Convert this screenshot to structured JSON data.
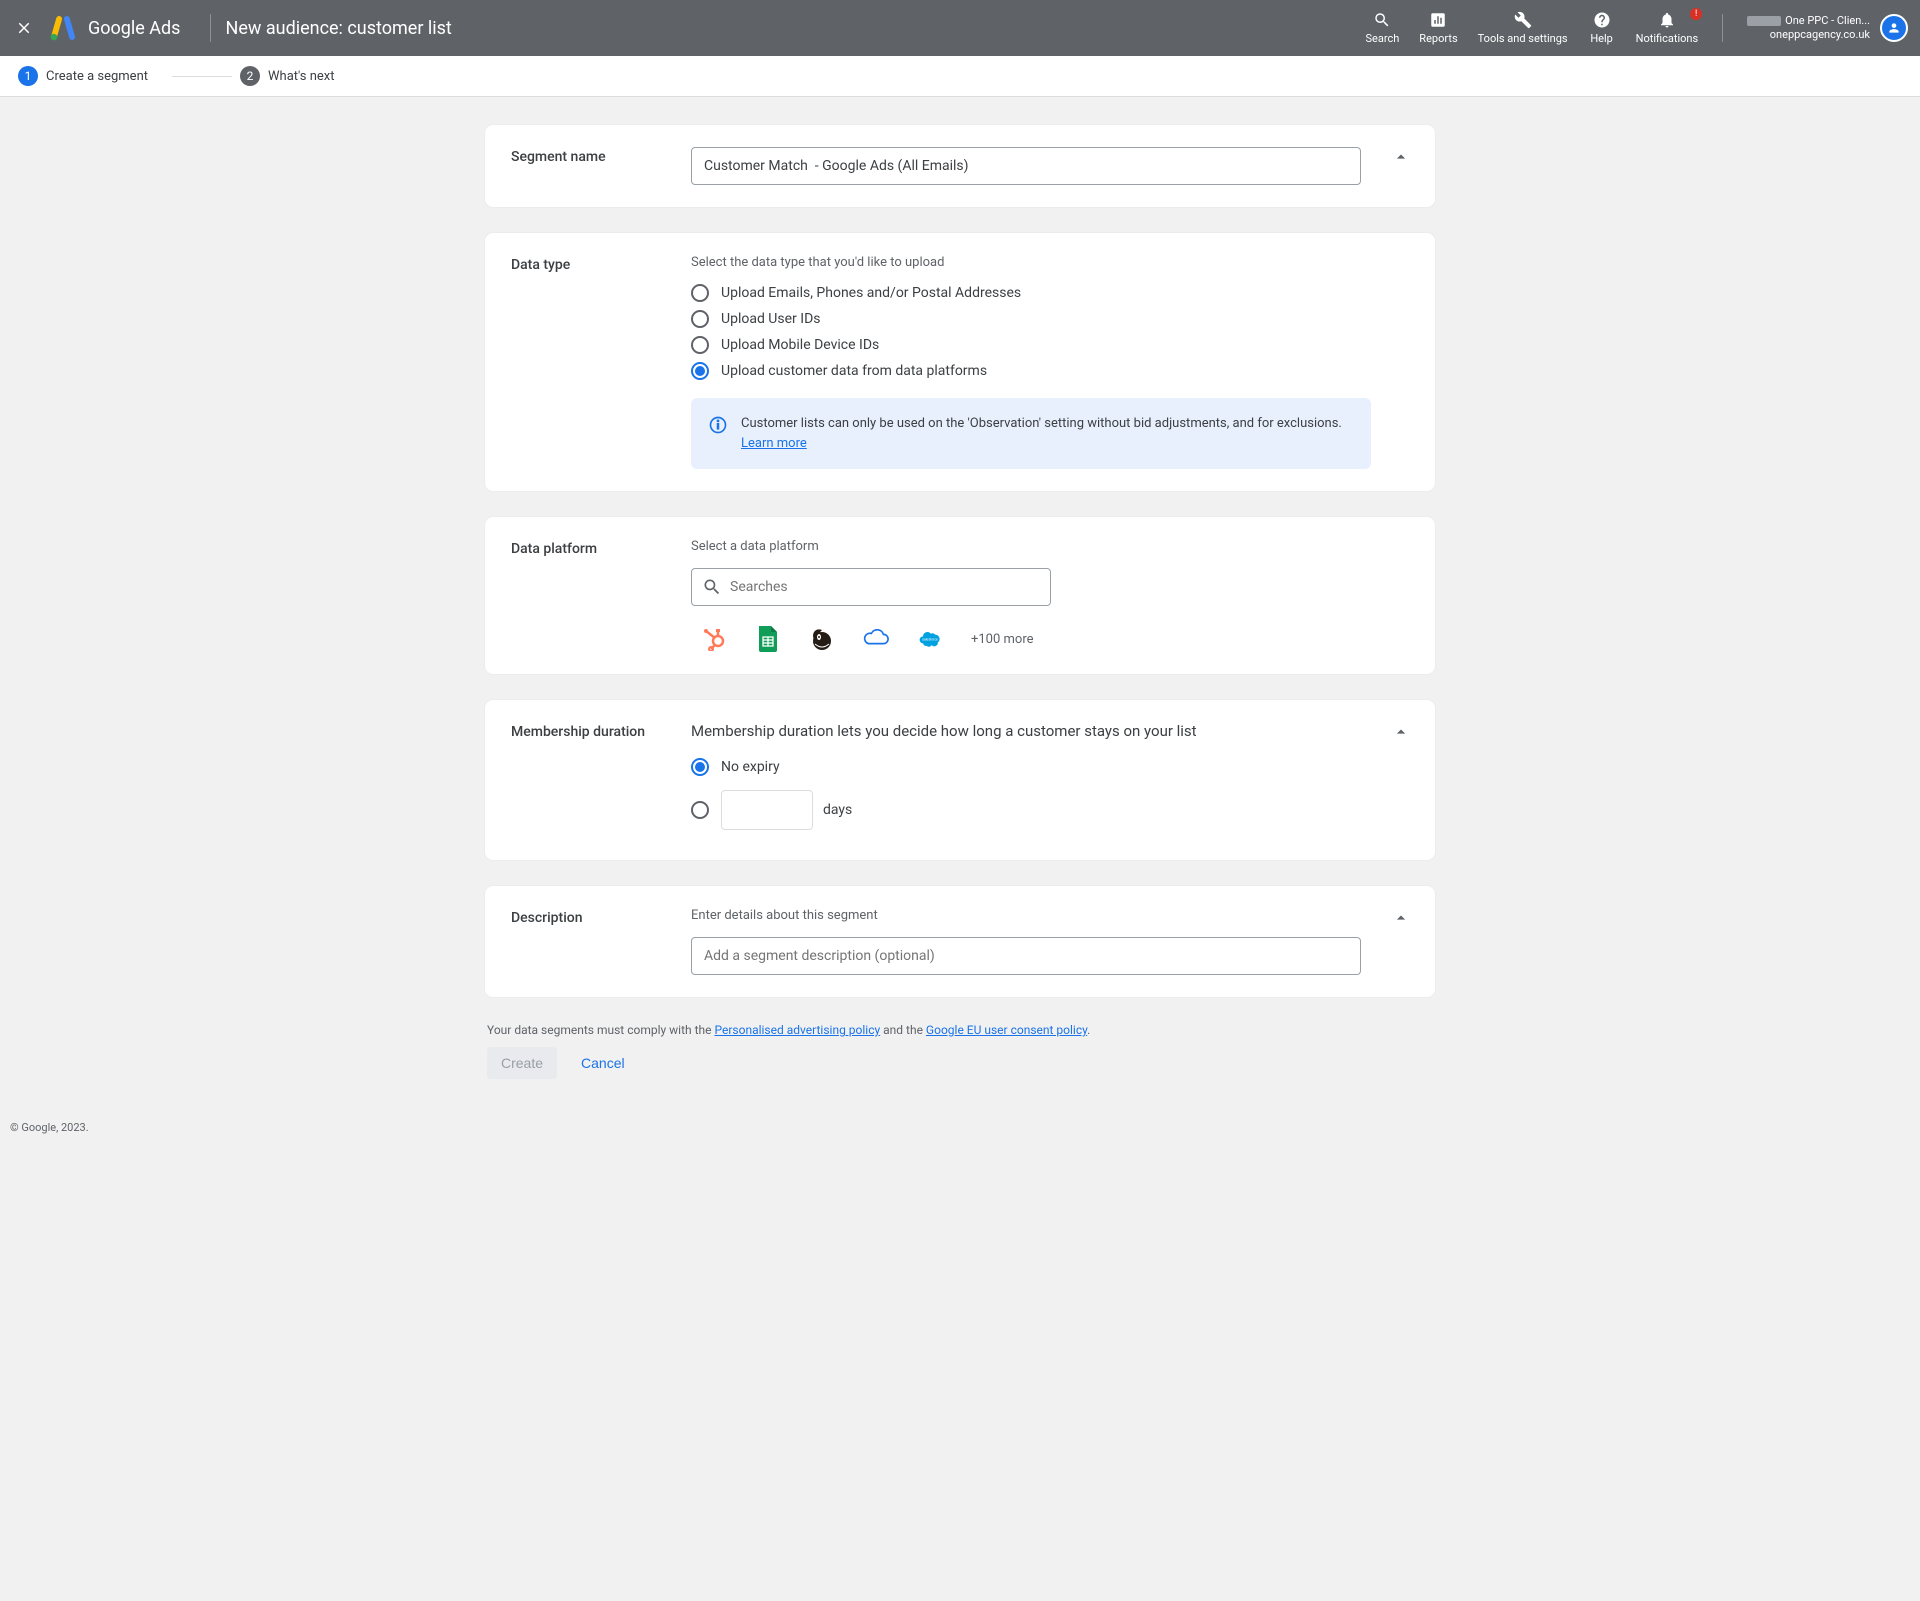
{
  "header": {
    "brand": "Google Ads",
    "page_title": "New audience: customer list",
    "tools": {
      "search": "Search",
      "reports": "Reports",
      "tools": "Tools and settings",
      "help": "Help",
      "notifications": "Notifications"
    },
    "account": {
      "line1": "One PPC - Clien...",
      "line2": "oneppcagency.co.uk"
    }
  },
  "stepper": {
    "step1": "Create a segment",
    "step2": "What's next"
  },
  "segment_name": {
    "label": "Segment name",
    "value": "Customer Match  - Google Ads (All Emails)"
  },
  "data_type": {
    "label": "Data type",
    "helper": "Select the data type that you'd like to upload",
    "options": [
      "Upload Emails, Phones and/or Postal Addresses",
      "Upload User IDs",
      "Upload Mobile Device IDs",
      "Upload customer data from data platforms"
    ],
    "info_text": "Customer lists can only be used on the 'Observation' setting without bid adjustments, and for exclusions.",
    "learn_more": "Learn more"
  },
  "data_platform": {
    "label": "Data platform",
    "helper": "Select a data platform",
    "search_placeholder": "Searches",
    "more": "+100 more"
  },
  "membership": {
    "label": "Membership duration",
    "helper": "Membership duration lets you decide how long a customer stays on your list",
    "no_expiry": "No expiry",
    "days_suffix": "days"
  },
  "description": {
    "label": "Description",
    "helper": "Enter details about this segment",
    "placeholder": "Add a segment description (optional)"
  },
  "footer": {
    "note_prefix": "Your data segments must comply with the ",
    "policy1": "Personalised advertising policy",
    "note_mid": " and the ",
    "policy2": "Google EU user consent policy",
    "note_suffix": ".",
    "create": "Create",
    "cancel": "Cancel",
    "copyright": "© Google, 2023."
  }
}
